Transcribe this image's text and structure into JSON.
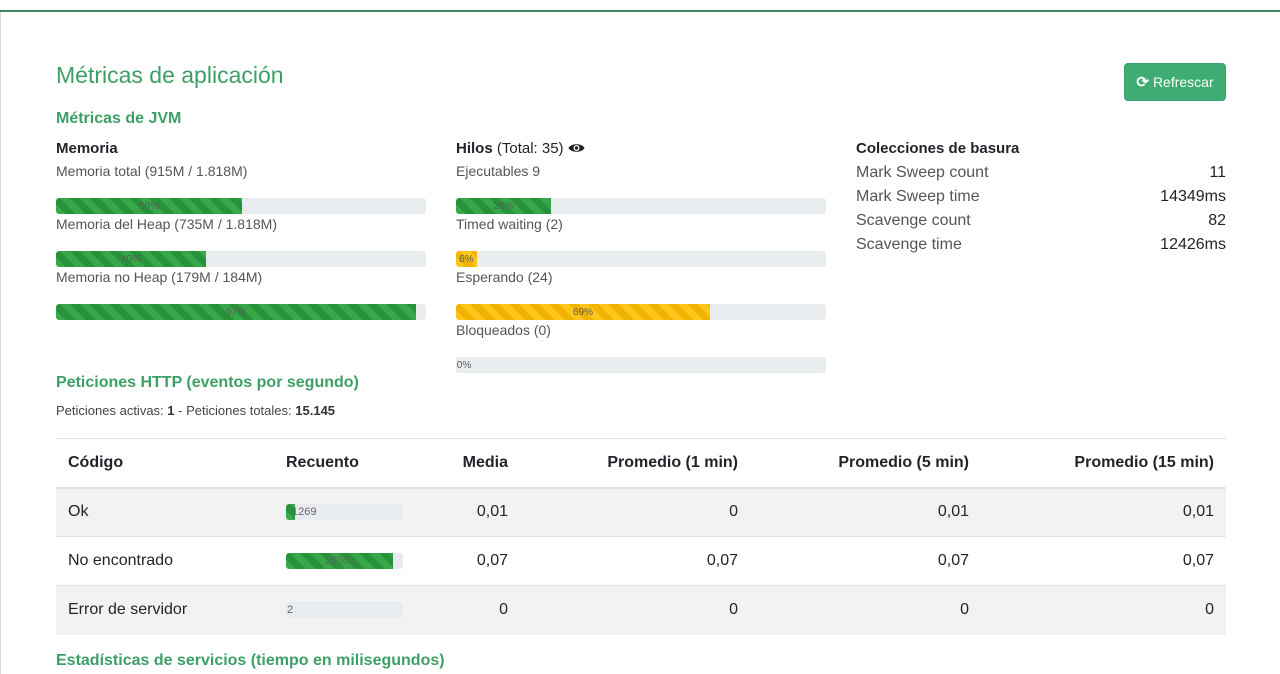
{
  "page": {
    "title": "Métricas de aplicación",
    "refresh_label": "Refrescar",
    "refresh_icon": "refresh-icon"
  },
  "jvm": {
    "title": "Métricas de JVM",
    "memory": {
      "title": "Memoria",
      "bars": [
        {
          "label": "Memoria total (915M / 1.818M)",
          "percent": 50,
          "text": "50%"
        },
        {
          "label": "Memoria del Heap (735M / 1.818M)",
          "percent": 40,
          "text": "40%"
        },
        {
          "label": "Memoria no Heap (179M / 184M)",
          "percent": 97,
          "text": "97%"
        }
      ]
    },
    "threads": {
      "title": "Hilos",
      "total": "(Total: 35)",
      "view_icon": "eye-icon",
      "bars": [
        {
          "label": "Ejecutables 9",
          "percent": 26,
          "text": "26%",
          "color": "green"
        },
        {
          "label": "Timed waiting (2)",
          "percent": 6,
          "text": "6%",
          "color": "yellow"
        },
        {
          "label": "Esperando (24)",
          "percent": 69,
          "text": "69%",
          "color": "yellow"
        },
        {
          "label": "Bloqueados (0)",
          "percent": 0,
          "text": "0%",
          "color": "green"
        }
      ]
    },
    "gc": {
      "title": "Colecciones de basura",
      "rows": [
        {
          "key": "Mark Sweep count",
          "value": "11"
        },
        {
          "key": "Mark Sweep time",
          "value": "14349ms"
        },
        {
          "key": "Scavenge count",
          "value": "82"
        },
        {
          "key": "Scavenge time",
          "value": "12426ms"
        }
      ]
    }
  },
  "http": {
    "title": "Peticiones HTTP (eventos por segundo)",
    "active_label": "Peticiones activas:",
    "active_value": "1",
    "separator": "-",
    "total_label": "Peticiones totales:",
    "total_value": "15.145",
    "columns": [
      "Código",
      "Recuento",
      "Media",
      "Promedio (1 min)",
      "Promedio (5 min)",
      "Promedio (15 min)"
    ],
    "rows": [
      {
        "code": "Ok",
        "count": "1269",
        "count_fraction": 0.08,
        "mean": "0,01",
        "m1": "0",
        "m5": "0,01",
        "m15": "0,01"
      },
      {
        "code": "No encontrado",
        "count": "13861",
        "count_fraction": 0.92,
        "mean": "0,07",
        "m1": "0,07",
        "m5": "0,07",
        "m15": "0,07"
      },
      {
        "code": "Error de servidor",
        "count": "2",
        "count_fraction": 0.0,
        "mean": "0",
        "m1": "0",
        "m5": "0",
        "m15": "0"
      }
    ]
  },
  "services": {
    "title": "Estadísticas de servicios (tiempo en milisegundos)"
  },
  "colors": {
    "accent": "#3e9f66",
    "button": "#3fad73",
    "bar_green": "#28a745",
    "bar_yellow": "#ffc107",
    "bar_track": "#e9ecef"
  }
}
